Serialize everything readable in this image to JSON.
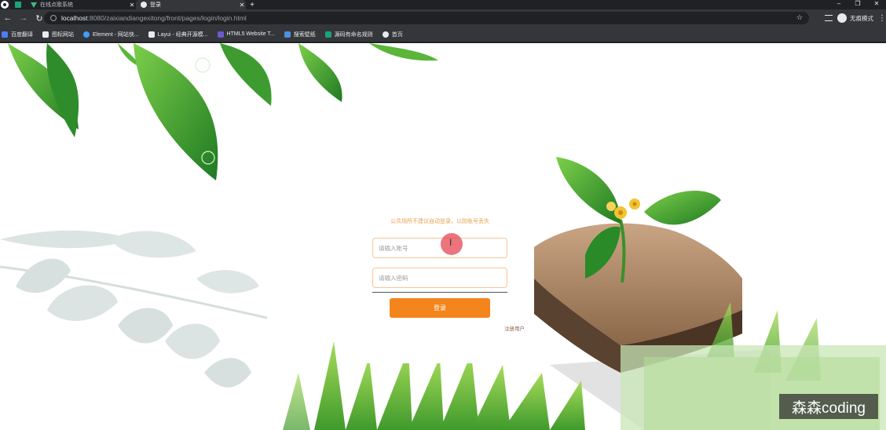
{
  "browser": {
    "tabs": [
      {
        "title": "在线点歌系统",
        "active": false
      },
      {
        "title": "登录",
        "active": true
      }
    ],
    "url": {
      "host": "localhost",
      "path": ":8080/zaixiandiangexitong/front/pages/login/login.html"
    },
    "incognito_label": "无痕模式",
    "bookmarks": [
      {
        "label": "百度翻译",
        "icon_color": "#4a7ef6"
      },
      {
        "label": "图标网站",
        "icon_color": "#e8eaed"
      },
      {
        "label": "Element - 网站快...",
        "icon_color": "#409eff"
      },
      {
        "label": "Layui - 经典开源模...",
        "icon_color": "#e8eaed"
      },
      {
        "label": "HTML5 Website T...",
        "icon_color": "#6a5acd"
      },
      {
        "label": "搜索壁纸",
        "icon_color": "#4a90e2"
      },
      {
        "label": "源码有命名规则",
        "icon_color": "#1ba37a"
      },
      {
        "label": "首页",
        "icon_color": "#e8eaed"
      }
    ]
  },
  "login": {
    "notice": "公共场所不建议自动登录，以防账号丢失",
    "username_placeholder": "请输入账号",
    "password_placeholder": "请输入密码",
    "login_button": "登录",
    "register_link": "注册用户"
  },
  "watermark": "森森coding",
  "colors": {
    "accent": "#f4841c",
    "notice": "#e8a04c",
    "field_border": "#f6c79a"
  }
}
